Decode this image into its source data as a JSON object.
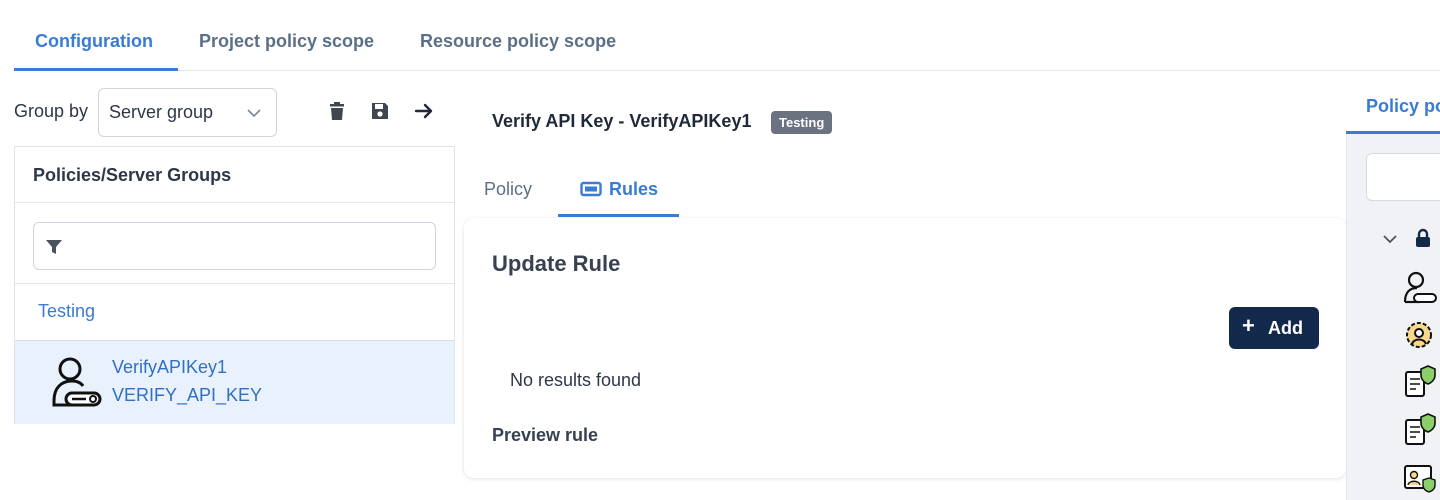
{
  "top_tabs": [
    {
      "label": "Configuration",
      "active": true
    },
    {
      "label": "Project policy scope",
      "active": false
    },
    {
      "label": "Resource policy scope",
      "active": false
    }
  ],
  "toolbar": {
    "group_by_label": "Group by",
    "group_by_value": "Server group",
    "icons": [
      "trash-icon",
      "save-icon",
      "arrow-right-icon"
    ]
  },
  "left_panel": {
    "header": "Policies/Server Groups",
    "filter_value": "",
    "group_name": "Testing",
    "item": {
      "name": "VerifyAPIKey1",
      "code": "VERIFY_API_KEY",
      "icon": "user-key-icon"
    }
  },
  "middle": {
    "title": "Verify API Key - VerifyAPIKey1",
    "badge": "Testing",
    "tabs": [
      {
        "label": "Policy",
        "active": false
      },
      {
        "label": "Rules",
        "active": true,
        "icon": "rules-icon"
      }
    ],
    "card": {
      "title": "Update Rule",
      "add_label": "Add",
      "no_results": "No results found",
      "preview_label": "Preview rule"
    }
  },
  "right_panel": {
    "tab_label": "Policy po",
    "icons": [
      "chevron-down-icon",
      "lock-icon",
      "user-key-icon",
      "gear-user-icon",
      "document-shield-icon",
      "document-shield-icon",
      "id-card-shield-icon"
    ]
  },
  "colors": {
    "accent": "#3a7bd5",
    "primary_button": "#13294b",
    "badge": "#6b7280",
    "selected_row": "#e9f2fc"
  }
}
